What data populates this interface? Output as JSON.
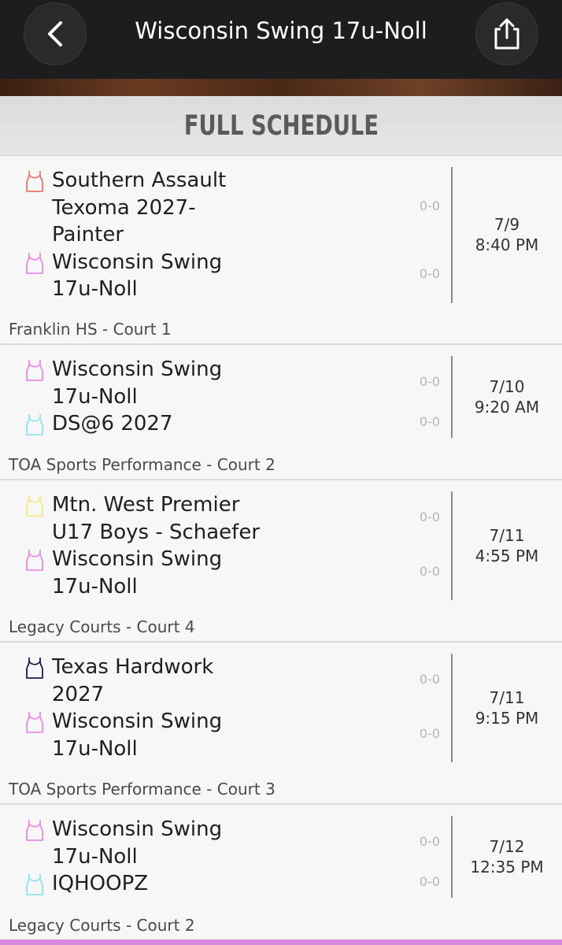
{
  "header": {
    "title": "Wisconsin Swing 17u-Noll"
  },
  "section": {
    "title": "FULL SCHEDULE"
  },
  "games": [
    {
      "home": {
        "name": "Southern Assault Texoma 2027-Painter",
        "lines": [
          "Southern Assault",
          "Texoma 2027-",
          "Painter"
        ],
        "record": "0-0",
        "jersey_color": "#e8786b"
      },
      "away": {
        "name": "Wisconsin Swing 17u-Noll",
        "lines": [
          "Wisconsin Swing",
          "17u-Noll"
        ],
        "record": "0-0",
        "jersey_color": "#e88ae6"
      },
      "date": "7/9",
      "time": "8:40 PM",
      "venue": "Franklin HS - Court 1"
    },
    {
      "home": {
        "name": "Wisconsin Swing 17u-Noll",
        "lines": [
          "Wisconsin Swing",
          "17u-Noll"
        ],
        "record": "0-0",
        "jersey_color": "#e88ae6"
      },
      "away": {
        "name": "DS@6 2027",
        "lines": [
          "DS@6 2027"
        ],
        "record": "0-0",
        "jersey_color": "#8ee4f0"
      },
      "date": "7/10",
      "time": "9:20 AM",
      "venue": "TOA Sports Performance - Court 2"
    },
    {
      "home": {
        "name": "Mtn. West Premier U17 Boys - Schaefer",
        "lines": [
          "Mtn. West Premier",
          "U17 Boys - Schaefer"
        ],
        "record": "0-0",
        "jersey_color": "#f2ea86"
      },
      "away": {
        "name": "Wisconsin Swing 17u-Noll",
        "lines": [
          "Wisconsin Swing",
          "17u-Noll"
        ],
        "record": "0-0",
        "jersey_color": "#e88ae6"
      },
      "date": "7/11",
      "time": "4:55 PM",
      "venue": "Legacy Courts - Court 4"
    },
    {
      "home": {
        "name": "Texas Hardwork 2027",
        "lines": [
          "Texas Hardwork",
          "2027"
        ],
        "record": "0-0",
        "jersey_color": "#1a1a4a"
      },
      "away": {
        "name": "Wisconsin Swing 17u-Noll",
        "lines": [
          "Wisconsin Swing",
          "17u-Noll"
        ],
        "record": "0-0",
        "jersey_color": "#e88ae6"
      },
      "date": "7/11",
      "time": "9:15 PM",
      "venue": "TOA Sports Performance - Court 3"
    },
    {
      "home": {
        "name": "Wisconsin Swing 17u-Noll",
        "lines": [
          "Wisconsin Swing",
          "17u-Noll"
        ],
        "record": "0-0",
        "jersey_color": "#e88ae6"
      },
      "away": {
        "name": "IQHOOPZ",
        "lines": [
          "IQHOOPZ"
        ],
        "record": "0-0",
        "jersey_color": "#8ee4f0"
      },
      "date": "7/12",
      "time": "12:35 PM",
      "venue": "Legacy Courts - Court 2"
    }
  ],
  "icons": {
    "back": "chevron-left-icon",
    "share": "share-icon",
    "jersey": "jersey-icon"
  }
}
